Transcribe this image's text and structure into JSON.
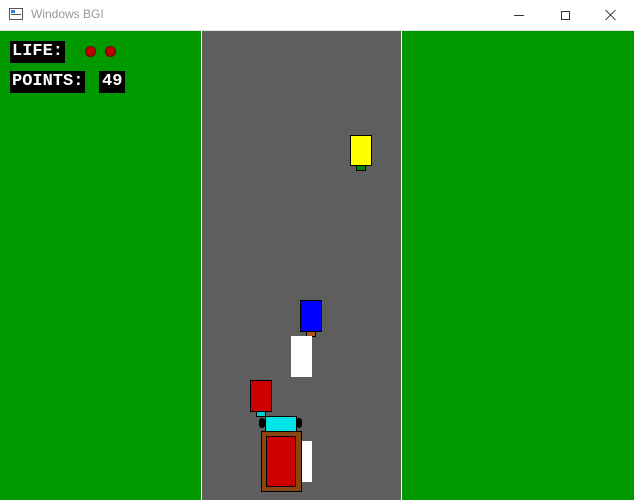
{
  "window": {
    "title": "Windows BGI",
    "buttons": [
      "minimize",
      "maximize",
      "close"
    ]
  },
  "hud": {
    "life_label": "LIFE:",
    "lives": 2,
    "points_label": "POINTS:",
    "points_value": "49"
  },
  "colors": {
    "grass": "#009900",
    "road": "#5e5e5e",
    "road_edge": "#ffffff",
    "life_dot": "#c00000"
  },
  "objects": [
    {
      "name": "yellow-car",
      "color": "#ffff00",
      "detail_color": "#008800"
    },
    {
      "name": "blue-car",
      "color": "#0000ff",
      "detail_color": "#aa5522"
    },
    {
      "name": "red-car",
      "color": "#cc0000",
      "detail_color": "#00cccc"
    },
    {
      "name": "player-truck",
      "body_color": "#8b4513",
      "cargo_color": "#cc0000",
      "cab_color": "#00e5e5"
    },
    {
      "name": "lane-marking",
      "color": "#ffffff"
    }
  ]
}
